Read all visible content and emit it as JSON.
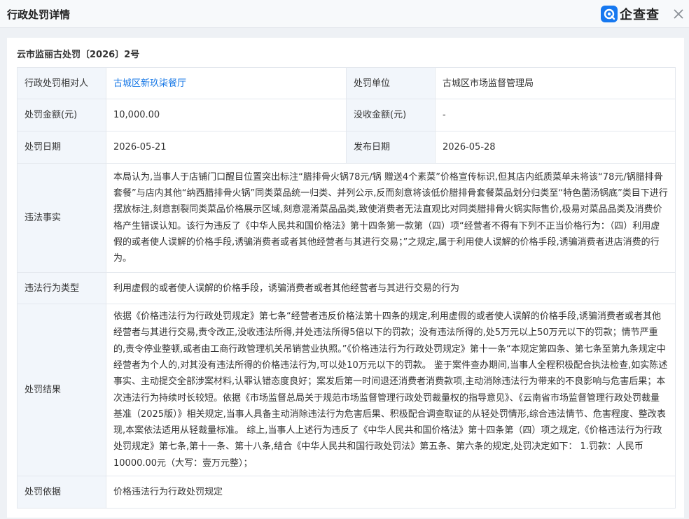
{
  "header": {
    "title": "行政处罚详情",
    "brand": "企查查"
  },
  "case": {
    "number": "云市监丽古处罚〔2026〕2号"
  },
  "rows": {
    "target": {
      "label": "行政处罚相对人",
      "value": "古城区新玖柒餐厅"
    },
    "unit": {
      "label": "处罚单位",
      "value": "古城区市场监督管理局"
    },
    "amount": {
      "label": "处罚金额(元)",
      "value": "10,000.00"
    },
    "confiscation": {
      "label": "没收金额(元)",
      "value": "-"
    },
    "date": {
      "label": "处罚日期",
      "value": "2026-05-21"
    },
    "publish_date": {
      "label": "发布日期",
      "value": "2026-05-28"
    },
    "facts": {
      "label": "违法事实",
      "value": "本局认为,当事人于店铺门口醒目位置突出标注“腊排骨火锅78元/锅 赠送4个素菜”价格宣传标识,但其店内纸质菜单未将该“78元/锅腊排骨套餐”与店内其他“纳西腊排骨火锅”同类菜品统一归类、并列公示,反而刻意将该低价腊排骨套餐菜品划分归类至“特色菌汤锅底”类目下进行摆放标注,刻意割裂同类菜品价格展示区域,刻意混淆菜品品类,致使消费者无法直观比对同类腊排骨火锅实际售价,极易对菜品品类及消费价格产生错误认知。该行为违反了《中华人民共和国价格法》第十四条第一款第（四）项“经营者不得有下列不正当价格行为：（四）利用虚假的或者使人误解的价格手段,诱骗消费者或者其他经营者与其进行交易；”之规定,属于利用使人误解的价格手段,诱骗消费者进店消费的行为。"
    },
    "violation_type": {
      "label": "违法行为类型",
      "value": "利用虚假的或者使人误解的价格手段，诱骗消费者或者其他经营者与其进行交易的行为"
    },
    "result": {
      "label": "处罚结果",
      "value": "依据《价格违法行为行政处罚规定》第七条“经营者违反价格法第十四条的规定,利用虚假的或者使人误解的价格手段,诱骗消费者或者其他经营者与其进行交易,责令改正,没收违法所得,并处违法所得5倍以下的罚款；没有违法所得的,处5万元以上50万元以下的罚款；情节严重的,责令停业整顿,或者由工商行政管理机关吊销营业执照。”《价格违法行为行政处罚规定》第十一条“本规定第四条、第七条至第九条规定中经营者为个人的,对其没有违法所得的价格违法行为,可以处10万元以下的罚款。 鉴于案件查办期间,当事人全程积极配合执法检查,如实陈述事实、主动提交全部涉案材料,认罪认错态度良好；案发后第一时间退还消费者消费款项,主动消除违法行为带来的不良影响与危害后果；本次违法行为持续时长较短。依据《市场监督总局关于规范市场监督管理行政处罚裁量权的指导意见》、《云南省市场监督管理行政处罚裁量基准（2025版）》相关规定,当事人具备主动消除违法行为危害后果、积极配合调查取证的从轻处罚情形,综合违法情节、危害程度、整改表现,本案依法适用从轻裁量标准。 综上,当事人上述行为违反了《中华人民共和国价格法》第十四条第（四）项之规定,《价格违法行为行政处罚规定》第七条,第十一条、第十八条,结合《中华人民共和国行政处罚法》第五条、第六条的规定,处罚决定如下： 1.罚款：人民币10000.00元（大写：壹万元整）；"
    },
    "basis": {
      "label": "处罚依据",
      "value": "价格违法行为行政处罚规定"
    }
  },
  "colors": {
    "accent": "#1677e6",
    "brand": "#1678f0",
    "label_bg": "#f2f6fb",
    "border": "#e4e8ee"
  },
  "icons": {
    "brand": "qcc-logo-icon",
    "close": "close-icon"
  }
}
